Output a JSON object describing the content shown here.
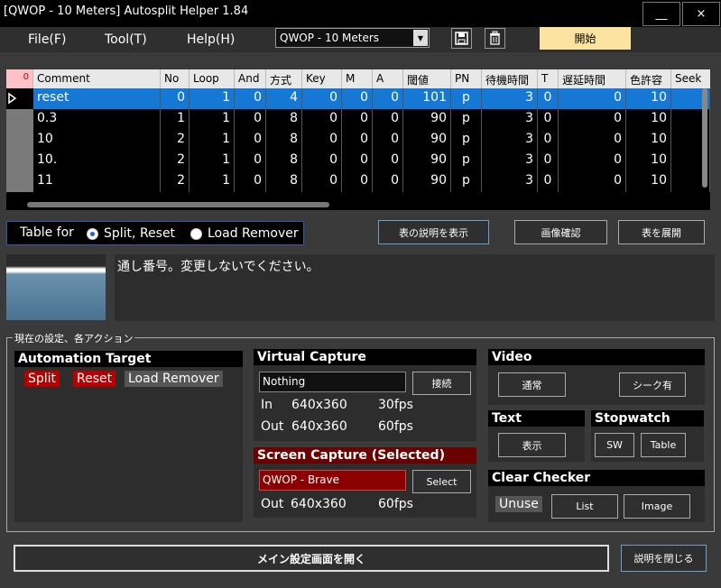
{
  "window": {
    "title": "[QWOP - 10 Meters] Autosplit Helper 1.84",
    "minimize_label": "__",
    "close_label": "×"
  },
  "menu": {
    "file": "File(F)",
    "tool": "Tool(T)",
    "help": "Help(H)"
  },
  "toolbar": {
    "game_selected": "QWOP - 10 Meters",
    "save_icon": "floppy-disk-icon",
    "delete_icon": "trash-icon",
    "start_label": "開始",
    "start_color": "#fde3a0"
  },
  "table": {
    "corner": "0",
    "columns": [
      "Comment",
      "No",
      "Loop",
      "And",
      "方式",
      "Key",
      "M",
      "A",
      "閾値",
      "PN",
      "待機時間",
      "T",
      "遅延時間",
      "色許容",
      "Seek"
    ],
    "rows": [
      [
        "reset",
        "0",
        "1",
        "0",
        "4",
        "0",
        "0",
        "0",
        "101",
        "p",
        "3",
        "0",
        "0",
        "10",
        ""
      ],
      [
        "0.3",
        "1",
        "1",
        "0",
        "8",
        "0",
        "0",
        "0",
        "90",
        "p",
        "3",
        "0",
        "0",
        "10",
        ""
      ],
      [
        "10",
        "2",
        "1",
        "0",
        "8",
        "0",
        "0",
        "0",
        "90",
        "p",
        "3",
        "0",
        "0",
        "10",
        ""
      ],
      [
        "10.",
        "2",
        "1",
        "0",
        "8",
        "0",
        "0",
        "0",
        "90",
        "p",
        "3",
        "0",
        "0",
        "10",
        ""
      ],
      [
        "11",
        "2",
        "1",
        "0",
        "8",
        "0",
        "0",
        "0",
        "90",
        "p",
        "3",
        "0",
        "0",
        "10",
        ""
      ]
    ],
    "selected_row_color": "#1478d4"
  },
  "table_for": {
    "label": "Table for",
    "option_split": "Split, Reset",
    "option_load": "Load Remover"
  },
  "actions": {
    "show_desc": "表の説明を表示",
    "image_check": "画像確認",
    "expand_table": "表を展開"
  },
  "description": "通し番号。変更しないでください。",
  "settings": {
    "group_label": "現在の設定、各アクション",
    "automation": {
      "title": "Automation Target",
      "split": "Split",
      "reset": "Reset",
      "load_remover": "Load Remover"
    },
    "virtual_capture": {
      "title": "Virtual Capture",
      "device": "Nothing",
      "connect": "接続",
      "in_label": "In",
      "in_res": "640x360",
      "in_fps": "30fps",
      "out_label": "Out",
      "out_res": "640x360",
      "out_fps": "60fps"
    },
    "screen_capture": {
      "title": "Screen Capture (Selected)",
      "window": "QWOP - Brave",
      "select": "Select",
      "out_label": "Out",
      "out_res": "640x360",
      "out_fps": "60fps"
    },
    "video": {
      "title": "Video",
      "normal": "通常",
      "seek": "シーク有"
    },
    "text": {
      "title": "Text",
      "show": "表示"
    },
    "stopwatch": {
      "title": "Stopwatch",
      "sw": "SW",
      "table": "Table"
    },
    "clear_checker": {
      "title": "Clear Checker",
      "unuse": "Unuse",
      "list": "List",
      "image": "Image"
    }
  },
  "bottom": {
    "open_main": "メイン設定画面を開く",
    "close_desc": "説明を閉じる"
  }
}
